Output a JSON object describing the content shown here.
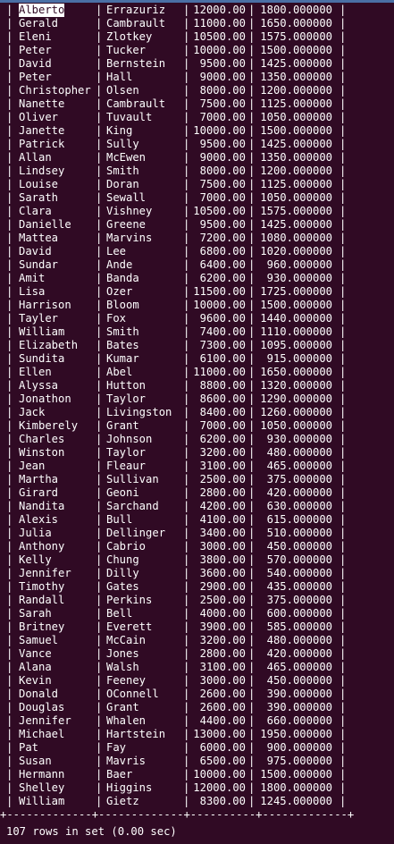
{
  "terminal": {
    "background": "#300a24",
    "foreground": "#ffffff",
    "rows": [
      {
        "first": "Alberto",
        "last": "Errazuriz",
        "salary": "12000.00",
        "commission": "1800.000000"
      },
      {
        "first": "Gerald",
        "last": "Cambrault",
        "salary": "11000.00",
        "commission": "1650.000000"
      },
      {
        "first": "Eleni",
        "last": "Zlotkey",
        "salary": "10500.00",
        "commission": "1575.000000"
      },
      {
        "first": "Peter",
        "last": "Tucker",
        "salary": "10000.00",
        "commission": "1500.000000"
      },
      {
        "first": "David",
        "last": "Bernstein",
        "salary": "9500.00",
        "commission": "1425.000000"
      },
      {
        "first": "Peter",
        "last": "Hall",
        "salary": "9000.00",
        "commission": "1350.000000"
      },
      {
        "first": "Christopher",
        "last": "Olsen",
        "salary": "8000.00",
        "commission": "1200.000000"
      },
      {
        "first": "Nanette",
        "last": "Cambrault",
        "salary": "7500.00",
        "commission": "1125.000000"
      },
      {
        "first": "Oliver",
        "last": "Tuvault",
        "salary": "7000.00",
        "commission": "1050.000000"
      },
      {
        "first": "Janette",
        "last": "King",
        "salary": "10000.00",
        "commission": "1500.000000"
      },
      {
        "first": "Patrick",
        "last": "Sully",
        "salary": "9500.00",
        "commission": "1425.000000"
      },
      {
        "first": "Allan",
        "last": "McEwen",
        "salary": "9000.00",
        "commission": "1350.000000"
      },
      {
        "first": "Lindsey",
        "last": "Smith",
        "salary": "8000.00",
        "commission": "1200.000000"
      },
      {
        "first": "Louise",
        "last": "Doran",
        "salary": "7500.00",
        "commission": "1125.000000"
      },
      {
        "first": "Sarath",
        "last": "Sewall",
        "salary": "7000.00",
        "commission": "1050.000000"
      },
      {
        "first": "Clara",
        "last": "Vishney",
        "salary": "10500.00",
        "commission": "1575.000000"
      },
      {
        "first": "Danielle",
        "last": "Greene",
        "salary": "9500.00",
        "commission": "1425.000000"
      },
      {
        "first": "Mattea",
        "last": "Marvins",
        "salary": "7200.00",
        "commission": "1080.000000"
      },
      {
        "first": "David",
        "last": "Lee",
        "salary": "6800.00",
        "commission": "1020.000000"
      },
      {
        "first": "Sundar",
        "last": "Ande",
        "salary": "6400.00",
        "commission": "960.000000"
      },
      {
        "first": "Amit",
        "last": "Banda",
        "salary": "6200.00",
        "commission": "930.000000"
      },
      {
        "first": "Lisa",
        "last": "Ozer",
        "salary": "11500.00",
        "commission": "1725.000000"
      },
      {
        "first": "Harrison",
        "last": "Bloom",
        "salary": "10000.00",
        "commission": "1500.000000"
      },
      {
        "first": "Tayler",
        "last": "Fox",
        "salary": "9600.00",
        "commission": "1440.000000"
      },
      {
        "first": "William",
        "last": "Smith",
        "salary": "7400.00",
        "commission": "1110.000000"
      },
      {
        "first": "Elizabeth",
        "last": "Bates",
        "salary": "7300.00",
        "commission": "1095.000000"
      },
      {
        "first": "Sundita",
        "last": "Kumar",
        "salary": "6100.00",
        "commission": "915.000000"
      },
      {
        "first": "Ellen",
        "last": "Abel",
        "salary": "11000.00",
        "commission": "1650.000000"
      },
      {
        "first": "Alyssa",
        "last": "Hutton",
        "salary": "8800.00",
        "commission": "1320.000000"
      },
      {
        "first": "Jonathon",
        "last": "Taylor",
        "salary": "8600.00",
        "commission": "1290.000000"
      },
      {
        "first": "Jack",
        "last": "Livingston",
        "salary": "8400.00",
        "commission": "1260.000000"
      },
      {
        "first": "Kimberely",
        "last": "Grant",
        "salary": "7000.00",
        "commission": "1050.000000"
      },
      {
        "first": "Charles",
        "last": "Johnson",
        "salary": "6200.00",
        "commission": "930.000000"
      },
      {
        "first": "Winston",
        "last": "Taylor",
        "salary": "3200.00",
        "commission": "480.000000"
      },
      {
        "first": "Jean",
        "last": "Fleaur",
        "salary": "3100.00",
        "commission": "465.000000"
      },
      {
        "first": "Martha",
        "last": "Sullivan",
        "salary": "2500.00",
        "commission": "375.000000"
      },
      {
        "first": "Girard",
        "last": "Geoni",
        "salary": "2800.00",
        "commission": "420.000000"
      },
      {
        "first": "Nandita",
        "last": "Sarchand",
        "salary": "4200.00",
        "commission": "630.000000"
      },
      {
        "first": "Alexis",
        "last": "Bull",
        "salary": "4100.00",
        "commission": "615.000000"
      },
      {
        "first": "Julia",
        "last": "Dellinger",
        "salary": "3400.00",
        "commission": "510.000000"
      },
      {
        "first": "Anthony",
        "last": "Cabrio",
        "salary": "3000.00",
        "commission": "450.000000"
      },
      {
        "first": "Kelly",
        "last": "Chung",
        "salary": "3800.00",
        "commission": "570.000000"
      },
      {
        "first": "Jennifer",
        "last": "Dilly",
        "salary": "3600.00",
        "commission": "540.000000"
      },
      {
        "first": "Timothy",
        "last": "Gates",
        "salary": "2900.00",
        "commission": "435.000000"
      },
      {
        "first": "Randall",
        "last": "Perkins",
        "salary": "2500.00",
        "commission": "375.000000"
      },
      {
        "first": "Sarah",
        "last": "Bell",
        "salary": "4000.00",
        "commission": "600.000000"
      },
      {
        "first": "Britney",
        "last": "Everett",
        "salary": "3900.00",
        "commission": "585.000000"
      },
      {
        "first": "Samuel",
        "last": "McCain",
        "salary": "3200.00",
        "commission": "480.000000"
      },
      {
        "first": "Vance",
        "last": "Jones",
        "salary": "2800.00",
        "commission": "420.000000"
      },
      {
        "first": "Alana",
        "last": "Walsh",
        "salary": "3100.00",
        "commission": "465.000000"
      },
      {
        "first": "Kevin",
        "last": "Feeney",
        "salary": "3000.00",
        "commission": "450.000000"
      },
      {
        "first": "Donald",
        "last": "OConnell",
        "salary": "2600.00",
        "commission": "390.000000"
      },
      {
        "first": "Douglas",
        "last": "Grant",
        "salary": "2600.00",
        "commission": "390.000000"
      },
      {
        "first": "Jennifer",
        "last": "Whalen",
        "salary": "4400.00",
        "commission": "660.000000"
      },
      {
        "first": "Michael",
        "last": "Hartstein",
        "salary": "13000.00",
        "commission": "1950.000000"
      },
      {
        "first": "Pat",
        "last": "Fay",
        "salary": "6000.00",
        "commission": "900.000000"
      },
      {
        "first": "Susan",
        "last": "Mavris",
        "salary": "6500.00",
        "commission": "975.000000"
      },
      {
        "first": "Hermann",
        "last": "Baer",
        "salary": "10000.00",
        "commission": "1500.000000"
      },
      {
        "first": "Shelley",
        "last": "Higgins",
        "salary": "12000.00",
        "commission": "1800.000000"
      },
      {
        "first": "William",
        "last": "Gietz",
        "salary": "8300.00",
        "commission": "1245.000000"
      }
    ],
    "border": "+-------------+-------------+----------+-------------+",
    "footer": "107 rows in set (0.00 sec)"
  }
}
